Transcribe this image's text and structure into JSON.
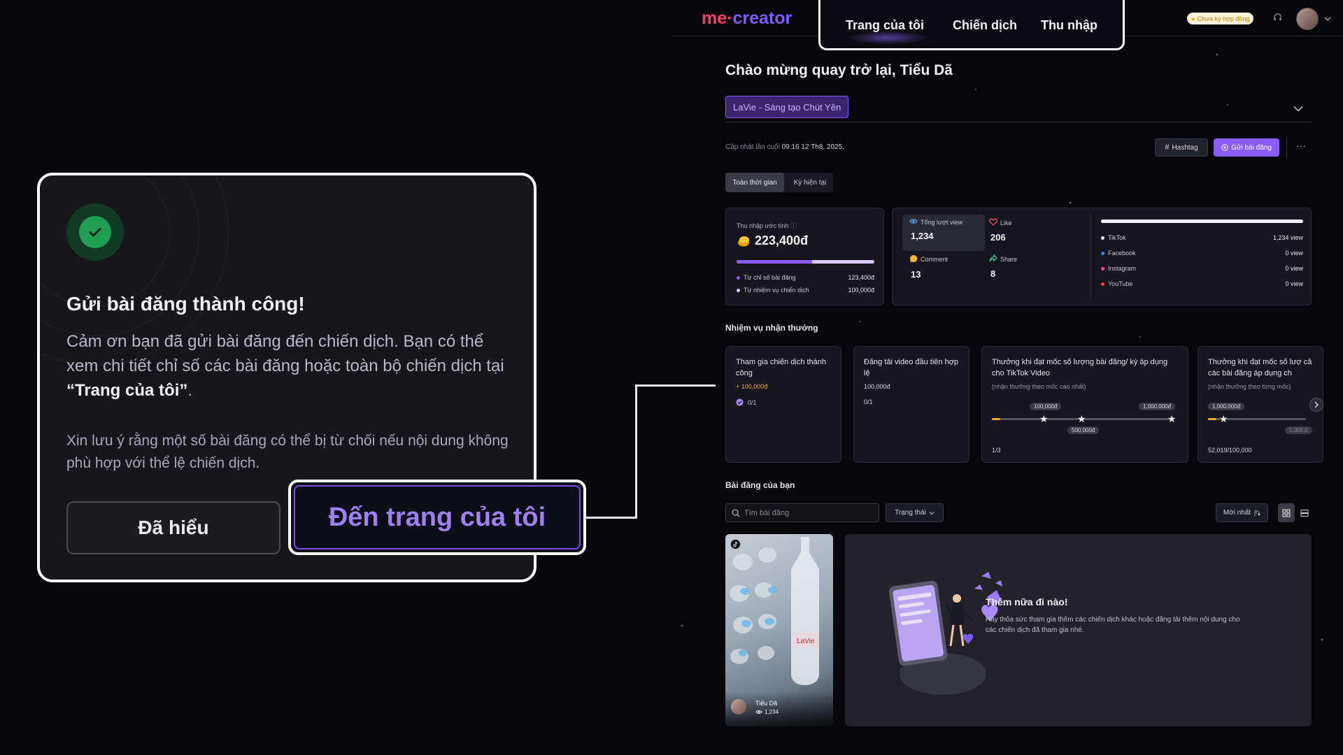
{
  "dialog": {
    "title": "Gửi bài đăng thành công!",
    "body_part1": "Cảm ơn bạn đã gửi bài đăng đến chiến dịch. Bạn có thể xem chi tiết chỉ số các bài đăng hoặc toàn bộ chiến dịch tại ",
    "body_link": "“Trang của tôi”",
    "body_part2": ".",
    "note": "Xin lưu ý rằng một số bài đăng có thể bị từ chối nếu nội dung không phù hợp với thể lệ chiến dịch.",
    "btn_ok": "Đã hiểu",
    "btn_goto": "Đến trang của tôi"
  },
  "app": {
    "logo_me": "me",
    "logo_dot": "·",
    "logo_creator": "creator",
    "nav": [
      "Trang của tôi",
      "Chiến dịch",
      "Thu nhập"
    ],
    "contract_badge": "Chưa ký hợp đồng",
    "welcome": "Chào mừng quay trở lại, Tiểu Dã",
    "campaign": "LaVie - Sáng tạo Chút Yên",
    "update_label": "Cập nhật lần cuối",
    "update_time": "09:16 12 Th8, 2025.",
    "btn_hashtag": "Hashtag",
    "btn_post": "Gửi bài đăng",
    "tabs": [
      "Toàn thời gian",
      "Kỳ hiện tại"
    ],
    "income": {
      "label": "Thu nhập ước tính",
      "value": "223,400đ",
      "split": 0.55,
      "rows": [
        {
          "label": "Từ chỉ số bài đăng",
          "value": "123,400đ",
          "color": "#8a5cff"
        },
        {
          "label": "Từ nhiệm vụ chiến dịch",
          "value": "100,000đ",
          "color": "#d9c9ff"
        }
      ]
    },
    "stats": [
      {
        "label": "Tổng lượt view",
        "value": "1,234",
        "icon": "eye-icon"
      },
      {
        "label": "Like",
        "value": "206",
        "icon": "heart-icon"
      },
      {
        "label": "Comment",
        "value": "13",
        "icon": "comment-icon"
      },
      {
        "label": "Share",
        "value": "8",
        "icon": "share-icon"
      }
    ],
    "platforms": [
      {
        "name": "TikTok",
        "value": "1,234 view",
        "color": "#e5e5ea"
      },
      {
        "name": "Facebook",
        "value": "0 view",
        "color": "#3b82f6"
      },
      {
        "name": "Instagram",
        "value": "0 view",
        "color": "#ec4899"
      },
      {
        "name": "YouTube",
        "value": "0 view",
        "color": "#ef4444"
      }
    ],
    "missions_title": "Nhiệm vụ nhận thưởng",
    "missions": [
      {
        "title": "Tham gia chiến dịch thành công",
        "reward": "+ 100,000đ",
        "progress": "0/1"
      },
      {
        "title": "Đăng tải video đầu tiên hợp lệ",
        "reward": "100,000đ",
        "progress": "0/1"
      },
      {
        "title": "Thưởng khi đạt mốc số lượng bài đăng/ kỳ áp dụng cho TikTok Video",
        "note": "(nhận thưởng theo mốc cao nhất)",
        "progress": "1/3",
        "milestones": [
          "100,000đ",
          "500,000đ",
          "1,000,000đ"
        ]
      },
      {
        "title": "Thưởng khi đạt mốc số lượ cả các bài đăng áp dụng ch",
        "note": "(nhận thưởng theo từng mốc)",
        "progress": "52,019/100,000",
        "milestones": [
          "1,000,000đ",
          "5,000,0"
        ]
      }
    ],
    "posts_title": "Bài đăng của bạn",
    "search_placeholder": "Tìm bài đăng",
    "status_filter": "Trạng thái",
    "sort": "Mới nhất",
    "post": {
      "author": "Tiểu Dã",
      "views": "1,234",
      "brand": "LaVie"
    },
    "empty": {
      "title": "Thêm nữa đi nào!",
      "desc": "Hãy thỏa sức tham gia thêm các chiến dịch khác hoặc đăng tải thêm nội dung cho các chiến dịch đã tham gia nhé."
    }
  }
}
